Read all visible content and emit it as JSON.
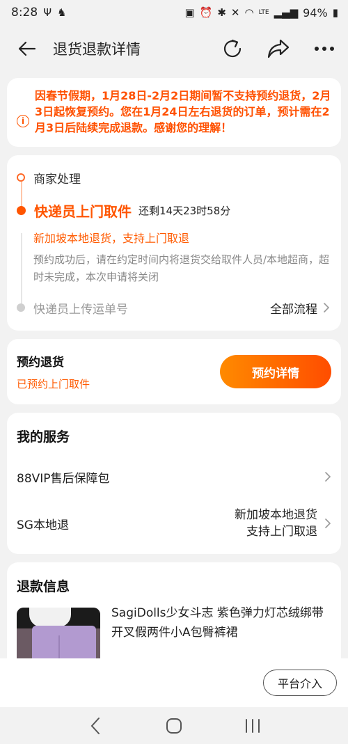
{
  "status_bar": {
    "time": "8:28",
    "battery": "94%",
    "network": "LTE"
  },
  "header": {
    "title": "退货退款详情",
    "icons": [
      "back-arrow-icon",
      "refresh-icon",
      "share-icon",
      "more-icon"
    ]
  },
  "notice": {
    "text": "因春节假期，1月28日-2月2日期间暂不支持预约退货，2月3日起恢复预约。您在1月24日左右退货的订单，预计需在2月3日后陆续完成退款。感谢您的理解！",
    "color": "#ff5000"
  },
  "timeline": {
    "step1": "商家处理",
    "active_title": "快递员上门取件",
    "active_remaining": "还剩14天23时58分",
    "active_subtitle": "新加坡本地退货，支持上门取退",
    "active_desc": "预约成功后，请在约定时间内将退货交给取件人员/本地超商，超时未完成，本次申请将关闭",
    "step3": "快递员上传运单号",
    "all_flow": "全部流程"
  },
  "booking": {
    "label": "预约退货",
    "status": "已预约上门取件",
    "button": "预约详情"
  },
  "services": {
    "title": "我的服务",
    "items": [
      {
        "label": "88VIP售后保障包",
        "value_line1": "",
        "value_line2": ""
      },
      {
        "label": "SG本地退",
        "value_line1": "新加坡本地退货",
        "value_line2": "支持上门取退"
      }
    ]
  },
  "refund": {
    "title": "退款信息",
    "product_name": "SagiDolls少女斗志 紫色弹力灯芯绒绑带开叉假两件小A包臀裤裙"
  },
  "bottom": {
    "platform_button": "平台介入"
  },
  "colors": {
    "accent": "#ff5500",
    "button_gradient_start": "#ff8a00",
    "button_gradient_end": "#ff4d00"
  }
}
